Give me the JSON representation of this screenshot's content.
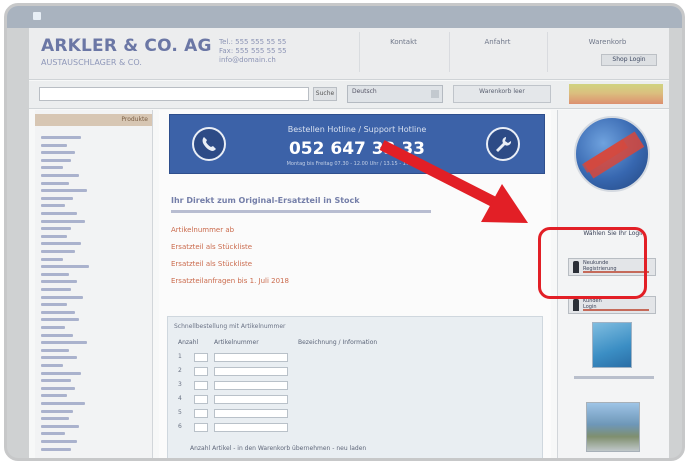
{
  "header": {
    "company_name": "ARKLER & CO. AG",
    "company_subline": "AUSTAUSCHLAGER & CO.",
    "contact_lines": [
      "Tel.: 555 555 55 55",
      "Fax: 555 555 55 55",
      "info@domain.ch"
    ],
    "nav": [
      "Kontakt",
      "Anfahrt",
      "Warenkorb"
    ],
    "shop_button": "Shop Login"
  },
  "search": {
    "placeholder": "",
    "go_label": "Suche",
    "language": "Deutsch",
    "cart_text": "Warenkorb leer"
  },
  "sidebar": {
    "title": "Produkte"
  },
  "banner": {
    "line1": "Bestellen Hotline / Support Hotline",
    "phone": "052 647 33 33",
    "line3": "Montag bis Freitag 07.30 - 12.00 Uhr / 13.15 - 17.00 Uhr"
  },
  "main": {
    "section_title": "Ihr Direkt zum Original-Ersatzteil in Stock",
    "order_links": [
      "Artikelnummer ab",
      "Ersatzteil als Stückliste",
      "Ersatzteil als Stückliste",
      "Ersatzteilanfragen bis 1. Juli 2018"
    ],
    "form_title": "Schnellbestellung mit Artikelnummer",
    "form_headers": [
      "Anzahl",
      "Artikelnummer",
      "Bezeichnung / Information"
    ],
    "form_rows": [
      "1",
      "2",
      "3",
      "4",
      "5",
      "6"
    ],
    "form_footer": "Anzahl Artikel - in den Warenkorb übernehmen - neu laden"
  },
  "rightcol": {
    "caption": "Wählen Sie Ihr Login",
    "buttons": [
      "Neukunde\nRegistrierung",
      "Kunden\nLogin"
    ]
  },
  "colors": {
    "banner_blue": "#3c62a8",
    "highlight_red": "#e21f26",
    "link_red": "#c2512e"
  },
  "icons": [
    "phone-icon",
    "wrench-icon",
    "person-icon",
    "globe-icon",
    "arrow-icon"
  ]
}
